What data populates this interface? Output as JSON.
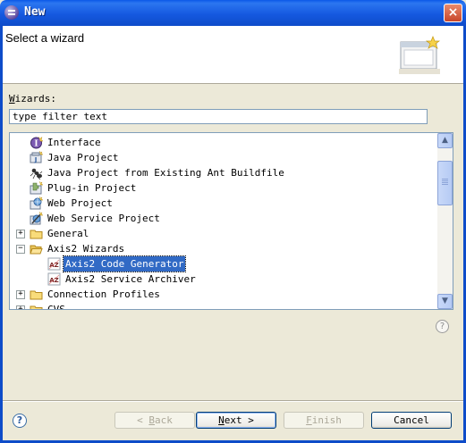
{
  "window": {
    "title": "New",
    "close_label": "×"
  },
  "banner": {
    "title": "Select a wizard"
  },
  "wizards_label_accel": "W",
  "wizards_label_rest": "izards:",
  "filter": {
    "value": "type filter text"
  },
  "tree": {
    "rows": [
      {
        "label": "Interface",
        "icon": "interface-icon",
        "indent": 1
      },
      {
        "label": "Java Project",
        "icon": "java-project-icon",
        "indent": 1
      },
      {
        "label": "Java Project from Existing Ant Buildfile",
        "icon": "ant-icon",
        "indent": 1
      },
      {
        "label": "Plug-in Project",
        "icon": "plugin-project-icon",
        "indent": 1
      },
      {
        "label": "Web Project",
        "icon": "web-project-icon",
        "indent": 1
      },
      {
        "label": "Web Service Project",
        "icon": "web-service-project-icon",
        "indent": 1
      },
      {
        "label": "General",
        "icon": "folder-icon",
        "indent": 0,
        "expander": "+"
      },
      {
        "label": "Axis2 Wizards",
        "icon": "folder-open-icon",
        "indent": 0,
        "expander": "−"
      },
      {
        "label": "Axis2 Code Generator",
        "icon": "axis2-icon",
        "indent": 2,
        "selected": true
      },
      {
        "label": "Axis2 Service Archiver",
        "icon": "axis2-icon",
        "indent": 2
      },
      {
        "label": "Connection Profiles",
        "icon": "folder-icon",
        "indent": 0,
        "expander": "+"
      },
      {
        "label": "CVS",
        "icon": "folder-icon",
        "indent": 0,
        "expander": "+"
      }
    ]
  },
  "buttons": {
    "back_accel": "B",
    "back_rest": "ack",
    "back_prefix": "< ",
    "next_accel": "N",
    "next_rest": "ext >",
    "finish_accel": "F",
    "finish_rest": "inish",
    "cancel": "Cancel"
  },
  "help_glyph": "?",
  "colors": {
    "titlebar": "#0E4CC9",
    "selection": "#316AC5",
    "dialog_bg": "#ECE9D8"
  }
}
